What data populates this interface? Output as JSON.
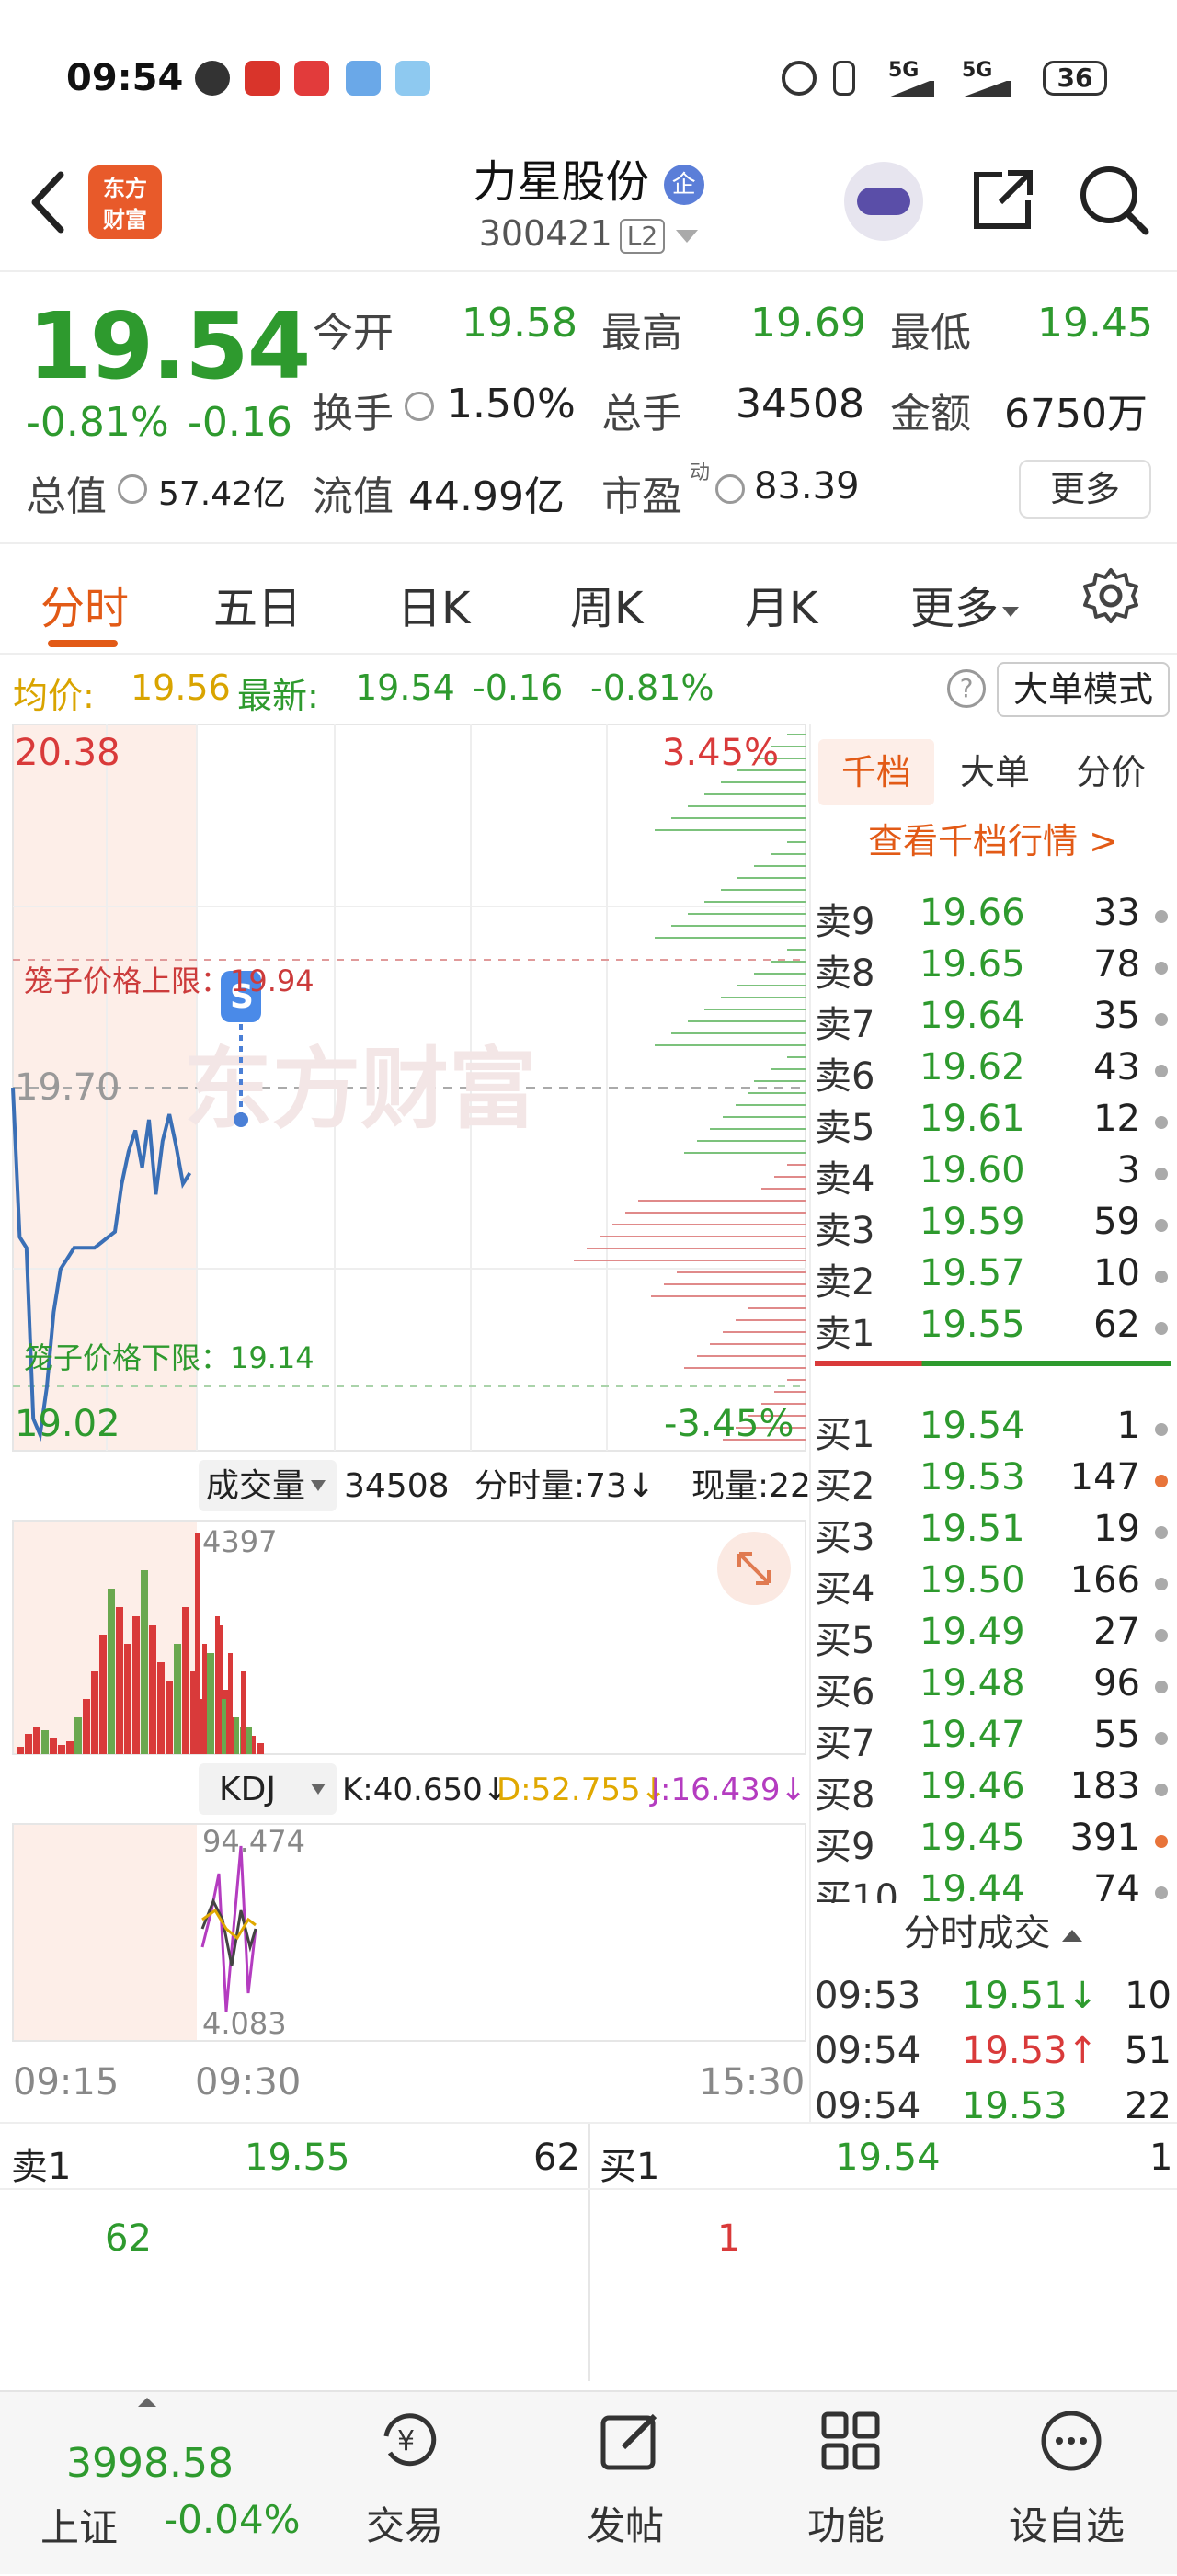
{
  "status_bar": {
    "time": "09:54",
    "battery": "36",
    "net1": "5G",
    "net2": "5G"
  },
  "header": {
    "name": "力星股份",
    "enterprise_badge": "企",
    "code": "300421",
    "level": "L2",
    "logo_text_1": "东方",
    "logo_text_2": "财富"
  },
  "quote": {
    "price": "19.54",
    "change_pct": "-0.81%",
    "change": "-0.16",
    "open_label": "今开",
    "open": "19.58",
    "high_label": "最高",
    "high": "19.69",
    "low_label": "最低",
    "low": "19.45",
    "turnover_label": "换手",
    "turnover": "1.50%",
    "volume_label": "总手",
    "volume": "34508",
    "amount_label": "金额",
    "amount": "6750万",
    "mktcap_label": "总值",
    "mktcap": "57.42亿",
    "float_label": "流值",
    "float_cap": "44.99亿",
    "pe_label": "市盈",
    "pe_sup": "动",
    "pe": "83.39",
    "more": "更多"
  },
  "tabs": [
    "分时",
    "五日",
    "日K",
    "周K",
    "月K",
    "更多"
  ],
  "avg_line": {
    "avg_label": "均价:",
    "avg": "19.56",
    "latest_label": "最新:",
    "latest": "19.54",
    "chg": "-0.16",
    "pct": "-0.81%",
    "big_order_mode": "大单模式",
    "help": "?"
  },
  "chart": {
    "top_price": "20.38",
    "top_pct": "3.45%",
    "bottom_price": "19.02",
    "bottom_pct": "-3.45%",
    "prev_close": "19.70",
    "cage_upper": "笼子价格上限：19.94",
    "cage_lower": "笼子价格下限：19.14",
    "watermark": "东方财富",
    "s_marker": "S",
    "volume_label": "成交量",
    "volume_total": "34508",
    "minute_vol": "分时量:73↓",
    "current_vol": "现量:22",
    "vol_max": "4397",
    "kdj_label": "KDJ",
    "k": "K:40.650↓",
    "d": "D:52.755↓",
    "j": "J:16.439↓",
    "kdj_max": "94.474",
    "kdj_min": "4.083",
    "time_start": "09:15",
    "time_open": "09:30",
    "time_end": "15:30"
  },
  "chart_data": {
    "type": "line",
    "title": "",
    "ylim": [
      19.02,
      20.38
    ],
    "prev_close": 19.7,
    "series": [
      {
        "name": "price",
        "x_minutes_from_0915": [
          0,
          1,
          2,
          3,
          4,
          5,
          6,
          7,
          8,
          9,
          10,
          11,
          12,
          13,
          14,
          15,
          16,
          17,
          18,
          19,
          20,
          21,
          22,
          23,
          24,
          25,
          26
        ],
        "values": [
          19.7,
          19.42,
          19.4,
          19.08,
          19.05,
          19.14,
          19.28,
          19.36,
          19.38,
          19.4,
          19.4,
          19.4,
          19.4,
          19.41,
          19.42,
          19.43,
          19.52,
          19.58,
          19.62,
          19.55,
          19.64,
          19.5,
          19.6,
          19.65,
          19.59,
          19.52,
          19.54
        ]
      }
    ]
  },
  "book": {
    "tabs": [
      "千档",
      "大单",
      "分价"
    ],
    "view_link": "查看千档行情 >",
    "asks": [
      {
        "label": "卖9",
        "price": "19.66",
        "vol": "33"
      },
      {
        "label": "卖8",
        "price": "19.65",
        "vol": "78"
      },
      {
        "label": "卖7",
        "price": "19.64",
        "vol": "35"
      },
      {
        "label": "卖6",
        "price": "19.62",
        "vol": "43"
      },
      {
        "label": "卖5",
        "price": "19.61",
        "vol": "12"
      },
      {
        "label": "卖4",
        "price": "19.60",
        "vol": "3"
      },
      {
        "label": "卖3",
        "price": "19.59",
        "vol": "59"
      },
      {
        "label": "卖2",
        "price": "19.57",
        "vol": "10"
      },
      {
        "label": "卖1",
        "price": "19.55",
        "vol": "62"
      }
    ],
    "bids": [
      {
        "label": "买1",
        "price": "19.54",
        "vol": "1"
      },
      {
        "label": "买2",
        "price": "19.53",
        "vol": "147"
      },
      {
        "label": "买3",
        "price": "19.51",
        "vol": "19"
      },
      {
        "label": "买4",
        "price": "19.50",
        "vol": "166"
      },
      {
        "label": "买5",
        "price": "19.49",
        "vol": "27"
      },
      {
        "label": "买6",
        "price": "19.48",
        "vol": "96"
      },
      {
        "label": "买7",
        "price": "19.47",
        "vol": "55"
      },
      {
        "label": "买8",
        "price": "19.46",
        "vol": "183"
      },
      {
        "label": "买9",
        "price": "19.45",
        "vol": "391"
      },
      {
        "label": "买10",
        "price": "19.44",
        "vol": "74"
      }
    ],
    "ticks_title": "分时成交",
    "ticks": [
      {
        "time": "09:53",
        "price": "19.51↓",
        "vol": "10"
      },
      {
        "time": "09:54",
        "price": "19.53↑",
        "vol": "51"
      },
      {
        "time": "09:54",
        "price": "19.53",
        "vol": "22"
      }
    ]
  },
  "level1": {
    "ask_label": "卖1",
    "ask_price": "19.55",
    "ask_vol": "62",
    "bid_label": "买1",
    "bid_price": "19.54",
    "bid_vol": "1",
    "ask_queue": "62",
    "bid_queue": "1"
  },
  "nav": {
    "index_value": "3998.58",
    "index_name": "上证",
    "index_pct": "-0.04%",
    "items": [
      "交易",
      "发帖",
      "功能",
      "设自选"
    ]
  },
  "colors": {
    "up": "#d93a3a",
    "down": "#2e9a2e",
    "accent": "#e25a16"
  }
}
